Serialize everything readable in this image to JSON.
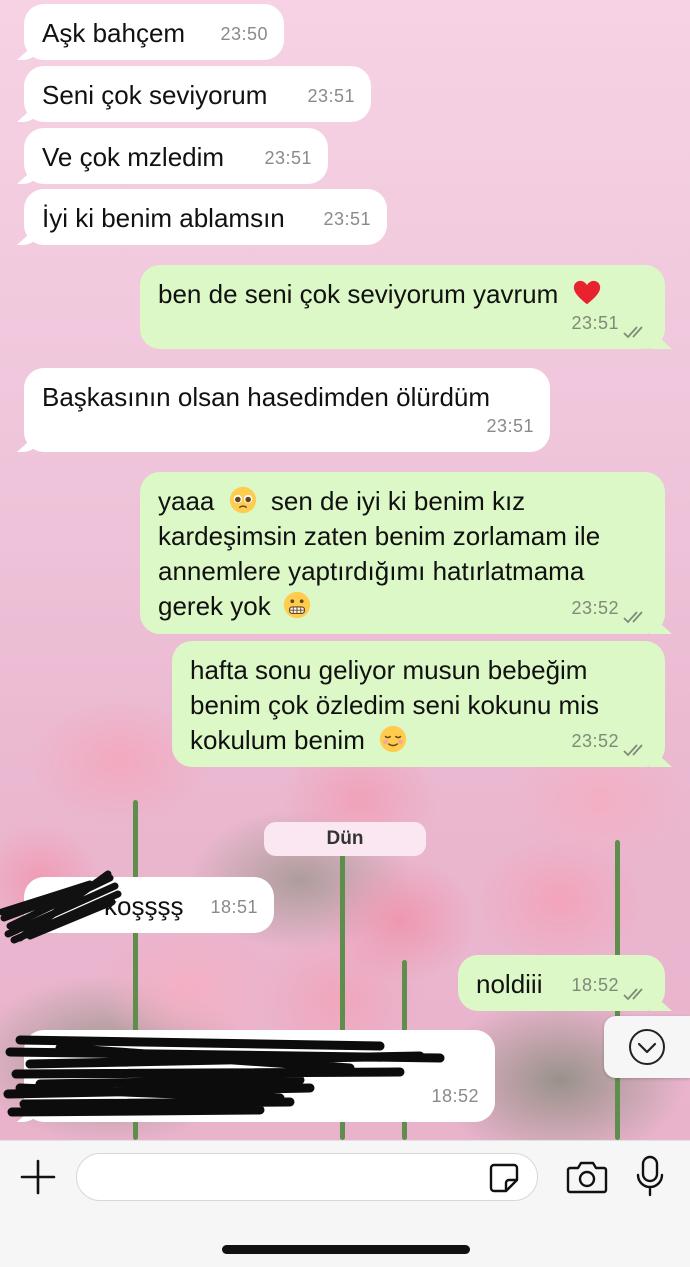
{
  "messages": [
    {
      "text": "Aşk bahçem",
      "time": "23:50"
    },
    {
      "text": "Seni çok seviyorum",
      "time": "23:51"
    },
    {
      "text": "Ve çok mzledim",
      "time": "23:51"
    },
    {
      "text": "İyi ki benim ablamsın",
      "time": "23:51"
    },
    {
      "text": "ben de seni çok seviyorum yavrum",
      "emoji": "red-heart",
      "time": "23:51"
    },
    {
      "text": "Başkasının olsan hasedimden ölürdüm",
      "time": "23:51"
    },
    {
      "lines": [
        "yaaa",
        "sen de iyi ki benim kız",
        "kardeşimsin zaten benim zorlamam ile",
        "annemlere yaptırdığımı hatırlatmama",
        "gerek yok"
      ],
      "emoji_a": "pleading-face",
      "emoji_b": "grimacing-face",
      "time": "23:52"
    },
    {
      "lines": [
        "hafta sonu geliyor musun bebeğim",
        "benim çok özledim seni kokunu mis",
        "kokulum benim"
      ],
      "emoji": "relieved-face",
      "time": "23:52"
    },
    {
      "text": "koşşşş",
      "time": "18:51"
    },
    {
      "text": "noldiii",
      "time": "18:52"
    },
    {
      "time": "18:52"
    }
  ],
  "date_separator": "Dün",
  "input": {
    "value": ""
  },
  "icons": {
    "plus": "plus-icon",
    "sticker": "sticker-icon",
    "camera": "camera-icon",
    "mic": "microphone-icon",
    "scroll": "chevron-down-icon",
    "read": "double-check-icon"
  },
  "colors": {
    "incoming": "#ffffff",
    "outgoing": "#dcf8c6",
    "read_ticks": "#7f8a78"
  }
}
